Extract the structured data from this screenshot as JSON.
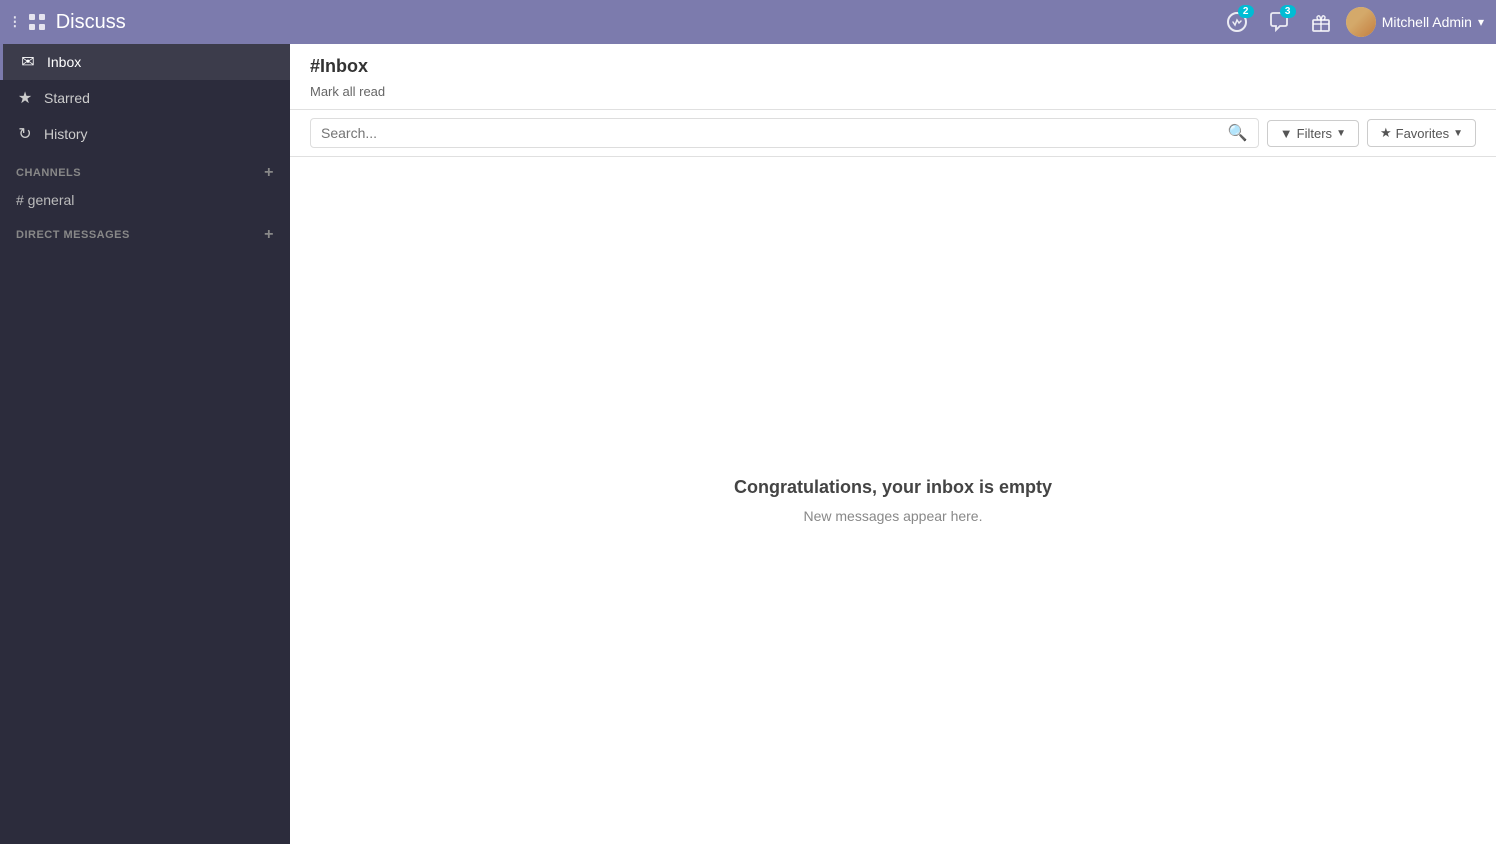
{
  "topbar": {
    "grid_icon": "⊞",
    "title": "Discuss",
    "icons": {
      "activity_badge": "2",
      "chat_badge": "3"
    },
    "user": {
      "name": "Mitchell Admin",
      "chevron": "▾"
    }
  },
  "content_header": {
    "title": "#Inbox",
    "mark_all_read": "Mark all read"
  },
  "search_bar": {
    "placeholder": "Search...",
    "filters_label": "Filters",
    "favorites_label": "Favorites"
  },
  "sidebar": {
    "nav_items": [
      {
        "id": "inbox",
        "label": "Inbox",
        "icon": "✉",
        "active": true
      },
      {
        "id": "starred",
        "label": "Starred",
        "icon": "☆",
        "active": false
      },
      {
        "id": "history",
        "label": "History",
        "icon": "↺",
        "active": false
      }
    ],
    "sections": [
      {
        "id": "channels",
        "label": "CHANNELS",
        "items": [
          {
            "id": "general",
            "label": "# general"
          }
        ]
      },
      {
        "id": "direct_messages",
        "label": "DIRECT MESSAGES",
        "items": []
      }
    ]
  },
  "empty_state": {
    "title": "Congratulations, your inbox is empty",
    "subtitle": "New messages appear here."
  }
}
